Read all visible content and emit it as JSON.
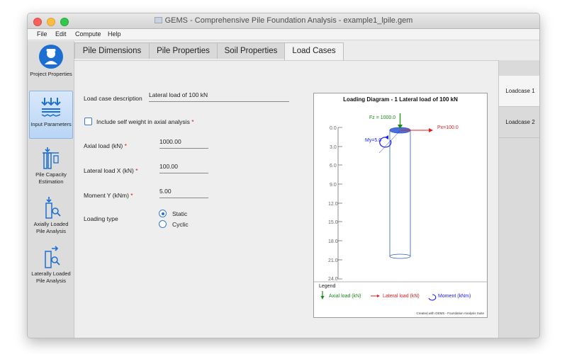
{
  "window": {
    "title": "GEMS - Comprehensive Pile Foundation Analysis - example1_lpile.gem"
  },
  "menu": [
    "File",
    "Edit",
    "Compute",
    "Help"
  ],
  "sidebar": {
    "items": [
      {
        "label": "Project Properties",
        "icon": "engineer-avatar-icon"
      },
      {
        "label": "Input Parameters",
        "icon": "download-load-icon",
        "active": true
      },
      {
        "label": "Pile Capacity Estimation",
        "icon": "pile-capacity-icon"
      },
      {
        "label": "Axially Loaded Pile Analysis",
        "icon": "axial-pile-icon"
      },
      {
        "label": "Laterally Loaded Pile Analysis",
        "icon": "lateral-pile-icon"
      }
    ]
  },
  "tabs": [
    "Pile Dimensions",
    "Pile Properties",
    "Soil Properties",
    "Load Cases"
  ],
  "active_tab": "Load Cases",
  "loadcases": [
    "Loadcase 1",
    "Loadcase 2"
  ],
  "form": {
    "description_label": "Load case description",
    "description_value": "Lateral load of 100 kN",
    "self_weight_label": "Include self weight in axial analysis",
    "self_weight_checked": false,
    "axial_label": "Axial load (kN)",
    "axial_value": "1000.00",
    "lateral_label": "Lateral load X (kN)",
    "lateral_value": "100.00",
    "moment_label": "Moment Y (kNm)",
    "moment_value": "5.00",
    "loading_type_label": "Loading type",
    "options": [
      "Static",
      "Cyclic"
    ],
    "selected": "Static",
    "required_mark": "*"
  },
  "diagram": {
    "title": "Loading Diagram - 1 Lateral load of 100 kN",
    "depth_ticks": [
      "0.0",
      "3.0",
      "6.0",
      "9.0",
      "12.0",
      "15.0",
      "18.0",
      "21.0",
      "24.0"
    ],
    "fz_label": "Fz = 1000.0",
    "px_label": "Px=100.0",
    "my_label": "My=5.0",
    "legend_title": "Legend",
    "legend_axial": "Axial load (kN)",
    "legend_lateral": "Lateral load (kN)",
    "legend_moment": "Moment (kNm)",
    "footer": "Created with GEMS - Foundation Analysis Suite",
    "colors": {
      "axial": "#1a8a1a",
      "lateral": "#e02020",
      "moment": "#1a1aff",
      "pile_top": "#4a6fd8"
    }
  }
}
